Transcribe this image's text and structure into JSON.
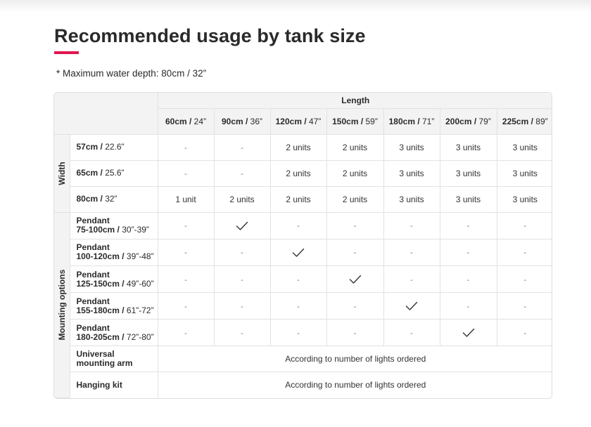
{
  "page": {
    "title": "Recommended usage by tank size",
    "note": "* Maximum water depth: 80cm / 32”",
    "accent_color": "#e0174f"
  },
  "table": {
    "length_header": "Length",
    "columns": [
      {
        "metric": "60cm /",
        "imperial": " 24”"
      },
      {
        "metric": "90cm /",
        "imperial": " 36”"
      },
      {
        "metric": "120cm /",
        "imperial": " 47”"
      },
      {
        "metric": "150cm /",
        "imperial": " 59”"
      },
      {
        "metric": "180cm /",
        "imperial": " 71”"
      },
      {
        "metric": "200cm /",
        "imperial": " 79”"
      },
      {
        "metric": "225cm /",
        "imperial": " 89”"
      }
    ],
    "width_group_label": "Width",
    "width_rows": [
      {
        "metric": "57cm /",
        "imperial": " 22.6”",
        "cells": [
          "-",
          "-",
          "2 units",
          "2 units",
          "3 units",
          "3 units",
          "3 units"
        ]
      },
      {
        "metric": "65cm /",
        "imperial": " 25.6”",
        "cells": [
          "-",
          "-",
          "2 units",
          "2 units",
          "3 units",
          "3 units",
          "3 units"
        ]
      },
      {
        "metric": "80cm /",
        "imperial": " 32”",
        "cells": [
          "1 unit",
          "2 units",
          "2 units",
          "2 units",
          "3 units",
          "3 units",
          "3 units"
        ]
      }
    ],
    "mounting_group_label": "Mounting options",
    "pendant_rows": [
      {
        "line1": "Pendant",
        "metric": "75-100cm /",
        "imperial": " 30”-39”",
        "cells": [
          "-",
          "check",
          "-",
          "-",
          "-",
          "-",
          "-"
        ]
      },
      {
        "line1": "Pendant",
        "metric": "100-120cm /",
        "imperial": " 39”-48”",
        "cells": [
          "-",
          "-",
          "check",
          "-",
          "-",
          "-",
          "-"
        ]
      },
      {
        "line1": "Pendant",
        "metric": "125-150cm /",
        "imperial": " 49”-60”",
        "cells": [
          "-",
          "-",
          "-",
          "check",
          "-",
          "-",
          "-"
        ]
      },
      {
        "line1": "Pendant",
        "metric": "155-180cm /",
        "imperial": " 61”-72”",
        "cells": [
          "-",
          "-",
          "-",
          "-",
          "check",
          "-",
          "-"
        ]
      },
      {
        "line1": "Pendant",
        "metric": "180-205cm /",
        "imperial": " 72”-80”",
        "cells": [
          "-",
          "-",
          "-",
          "-",
          "-",
          "check",
          "-"
        ]
      }
    ],
    "arm_row": {
      "line1": "Universal",
      "line2": "mounting arm",
      "value": "According to number of lights ordered"
    },
    "kit_row": {
      "label": "Hanging kit",
      "value": "According to number of lights ordered"
    }
  }
}
